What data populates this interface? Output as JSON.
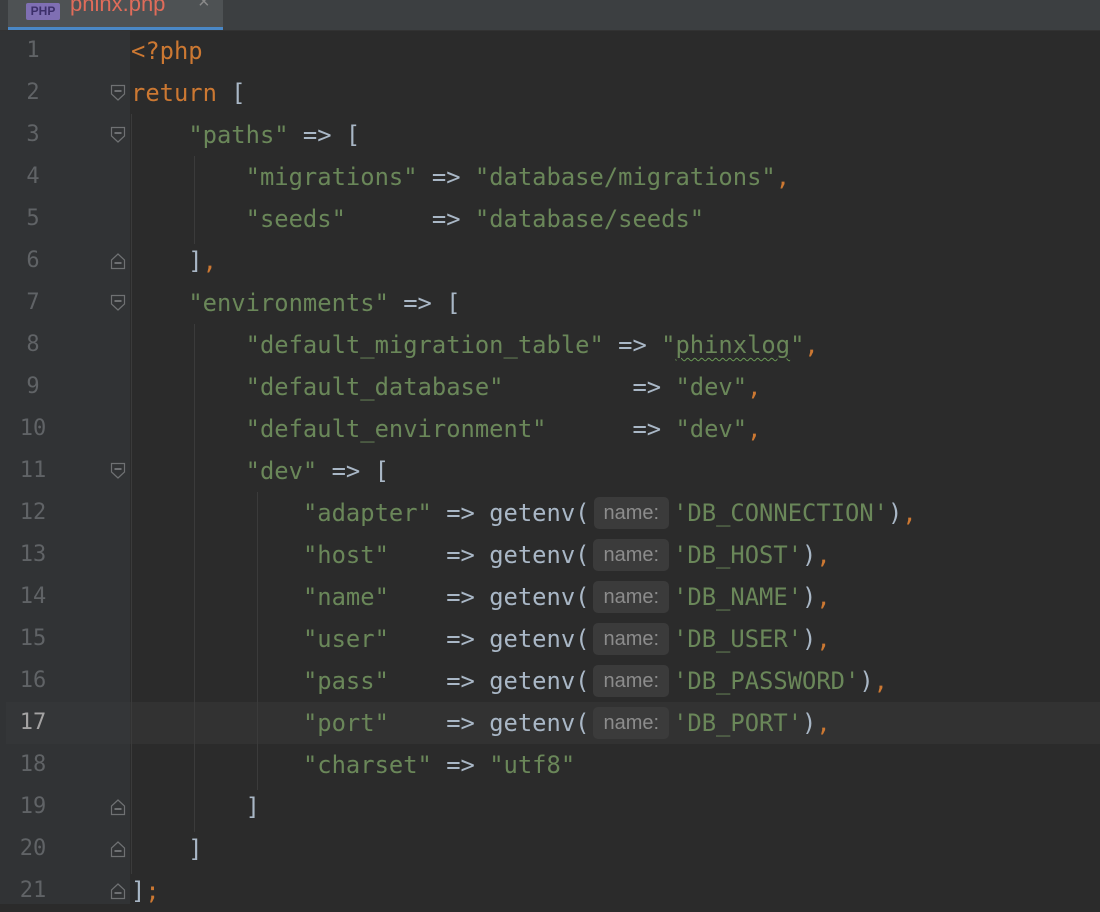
{
  "tab": {
    "icon_label": "PHP",
    "title": "phinx.php",
    "close": "×"
  },
  "editor": {
    "current_line": 17,
    "line_numbers": [
      "1",
      "2",
      "3",
      "4",
      "5",
      "6",
      "7",
      "8",
      "9",
      "10",
      "11",
      "12",
      "13",
      "14",
      "15",
      "16",
      "17",
      "18",
      "19",
      "20",
      "21"
    ],
    "hint_label": "name:",
    "lines": [
      [
        {
          "t": "<?php",
          "c": "kw"
        }
      ],
      [
        {
          "t": "return",
          "c": "kw"
        },
        {
          "t": " [",
          "c": "op"
        }
      ],
      [
        {
          "t": "    ",
          "c": "op"
        },
        {
          "t": "\"paths\"",
          "c": "str"
        },
        {
          "t": " => [",
          "c": "op"
        }
      ],
      [
        {
          "t": "        ",
          "c": "op"
        },
        {
          "t": "\"migrations\"",
          "c": "str"
        },
        {
          "t": " => ",
          "c": "op"
        },
        {
          "t": "\"database/migrations\"",
          "c": "str"
        },
        {
          "t": ",",
          "c": "punct"
        }
      ],
      [
        {
          "t": "        ",
          "c": "op"
        },
        {
          "t": "\"seeds\"",
          "c": "str"
        },
        {
          "t": "      => ",
          "c": "op"
        },
        {
          "t": "\"database/seeds\"",
          "c": "str"
        }
      ],
      [
        {
          "t": "    ],",
          "c": "op",
          "punct_last": true
        }
      ],
      [
        {
          "t": "    ",
          "c": "op"
        },
        {
          "t": "\"environments\"",
          "c": "str"
        },
        {
          "t": " => [",
          "c": "op"
        }
      ],
      [
        {
          "t": "        ",
          "c": "op"
        },
        {
          "t": "\"default_migration_table\"",
          "c": "str"
        },
        {
          "t": " => ",
          "c": "op"
        },
        {
          "t": "\"",
          "c": "str"
        },
        {
          "t": "phinxlog",
          "c": "str typo"
        },
        {
          "t": "\"",
          "c": "str"
        },
        {
          "t": ",",
          "c": "punct"
        }
      ],
      [
        {
          "t": "        ",
          "c": "op"
        },
        {
          "t": "\"default_database\"",
          "c": "str"
        },
        {
          "t": "         => ",
          "c": "op"
        },
        {
          "t": "\"dev\"",
          "c": "str"
        },
        {
          "t": ",",
          "c": "punct"
        }
      ],
      [
        {
          "t": "        ",
          "c": "op"
        },
        {
          "t": "\"default_environment\"",
          "c": "str"
        },
        {
          "t": "      => ",
          "c": "op"
        },
        {
          "t": "\"dev\"",
          "c": "str"
        },
        {
          "t": ",",
          "c": "punct"
        }
      ],
      [
        {
          "t": "        ",
          "c": "op"
        },
        {
          "t": "\"dev\"",
          "c": "str"
        },
        {
          "t": " => [",
          "c": "op"
        }
      ],
      [
        {
          "t": "            ",
          "c": "op"
        },
        {
          "t": "\"adapter\"",
          "c": "str"
        },
        {
          "t": " => getenv(",
          "c": "op"
        },
        {
          "hint": true
        },
        {
          "t": "'DB_CONNECTION'",
          "c": "str"
        },
        {
          "t": ")",
          "c": "op"
        },
        {
          "t": ",",
          "c": "punct"
        }
      ],
      [
        {
          "t": "            ",
          "c": "op"
        },
        {
          "t": "\"host\"",
          "c": "str"
        },
        {
          "t": "    => getenv(",
          "c": "op"
        },
        {
          "hint": true
        },
        {
          "t": "'DB_HOST'",
          "c": "str"
        },
        {
          "t": ")",
          "c": "op"
        },
        {
          "t": ",",
          "c": "punct"
        }
      ],
      [
        {
          "t": "            ",
          "c": "op"
        },
        {
          "t": "\"name\"",
          "c": "str"
        },
        {
          "t": "    => getenv(",
          "c": "op"
        },
        {
          "hint": true
        },
        {
          "t": "'DB_NAME'",
          "c": "str"
        },
        {
          "t": ")",
          "c": "op"
        },
        {
          "t": ",",
          "c": "punct"
        }
      ],
      [
        {
          "t": "            ",
          "c": "op"
        },
        {
          "t": "\"user\"",
          "c": "str"
        },
        {
          "t": "    => getenv(",
          "c": "op"
        },
        {
          "hint": true
        },
        {
          "t": "'DB_USER'",
          "c": "str"
        },
        {
          "t": ")",
          "c": "op"
        },
        {
          "t": ",",
          "c": "punct"
        }
      ],
      [
        {
          "t": "            ",
          "c": "op"
        },
        {
          "t": "\"pass\"",
          "c": "str"
        },
        {
          "t": "    => getenv(",
          "c": "op"
        },
        {
          "hint": true
        },
        {
          "t": "'DB_PASSWORD'",
          "c": "str"
        },
        {
          "t": ")",
          "c": "op"
        },
        {
          "t": ",",
          "c": "punct"
        }
      ],
      [
        {
          "t": "            ",
          "c": "op"
        },
        {
          "t": "\"port\"",
          "c": "str"
        },
        {
          "t": "    => getenv(",
          "c": "op"
        },
        {
          "hint": true
        },
        {
          "t": "'DB_PORT'",
          "c": "str"
        },
        {
          "t": ")",
          "c": "op"
        },
        {
          "t": ",",
          "c": "punct"
        }
      ],
      [
        {
          "t": "            ",
          "c": "op"
        },
        {
          "t": "\"charset\"",
          "c": "str"
        },
        {
          "t": " => ",
          "c": "op"
        },
        {
          "t": "\"utf8\"",
          "c": "str"
        }
      ],
      [
        {
          "t": "        ]",
          "c": "op"
        }
      ],
      [
        {
          "t": "    ]",
          "c": "op"
        }
      ],
      [
        {
          "t": "]",
          "c": "op"
        },
        {
          "t": ";",
          "c": "punct"
        }
      ]
    ],
    "fold_markers": [
      {
        "line": 2,
        "kind": "open"
      },
      {
        "line": 3,
        "kind": "open"
      },
      {
        "line": 6,
        "kind": "close"
      },
      {
        "line": 7,
        "kind": "open"
      },
      {
        "line": 11,
        "kind": "open"
      },
      {
        "line": 19,
        "kind": "close"
      },
      {
        "line": 20,
        "kind": "close"
      },
      {
        "line": 21,
        "kind": "close"
      }
    ]
  },
  "colors": {
    "keyword": "#cc7832",
    "string": "#6a8759",
    "default": "#a9b7c6",
    "background": "#2b2b2b"
  }
}
